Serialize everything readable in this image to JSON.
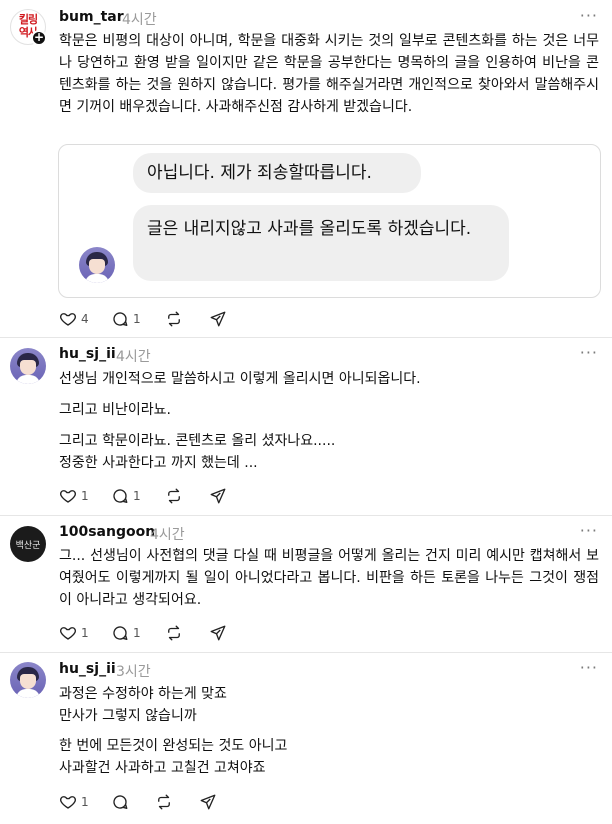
{
  "posts": [
    {
      "username": "bum_tar",
      "time": "4시간",
      "avatar_text": "킬링\n역사",
      "text": "학문은 비평의 대상이 아니며, 학문을 대중화 시키는 것의 일부로 콘텐츠화를 하는 것은 너무나 당연하고 환영 받을 일이지만 같은 학문을 공부한다는 명목하의 글을 인용하여 비난을 콘텐츠화를 하는 것을 원하지 않습니다. 평가를 해주실거라면 개인적으로 찾아와서 말씀해주시면 기꺼이 배우겠습니다. 사과해주신점 감사하게 받겠습니다.",
      "quote": {
        "bubble_1": "아닙니다. 제가 죄송할따릅니다.",
        "bubble_2": "글은 내리지않고 사과를 올리도록 하겠습니다."
      },
      "likes": "4",
      "replies": "1"
    },
    {
      "username": "hu_sj_ii",
      "time": "4시간",
      "paragraphs": [
        "선생님 개인적으로 말씀하시고 이렇게 올리시면 아니되옵니다.",
        "그리고 비난이라뇨.",
        "그리고 학문이라뇨. 콘텐츠로 올리 셨자나요.....\n정중한 사과한다고 까지 했는데 ..."
      ],
      "likes": "1",
      "replies": "1"
    },
    {
      "username": "100sangoon",
      "time": "4시간",
      "avatar_text": "백산군",
      "text": "그... 선생님이 사전협의 댓글 다실 때 비평글을 어떻게 올리는 건지 미리 예시만 캡쳐해서 보여줬어도 이렇게까지 될 일이 아니었다라고 봅니다. 비판을 하든 토론을 나누든 그것이 쟁점이 아니라고 생각되어요.",
      "likes": "1",
      "replies": "1"
    },
    {
      "username": "hu_sj_ii",
      "time": "3시간",
      "paragraphs": [
        "과정은 수정하야 하는게 맞죠\n만사가 그렇지 않습니까",
        "한 번에 모든것이 완성되는 것도 아니고\n사과할건 사과하고 고칠건 고쳐야죠"
      ],
      "likes": "1"
    }
  ],
  "icons": {
    "more": "more-icon",
    "like": "heart-icon",
    "reply": "comment-icon",
    "repost": "repost-icon",
    "share": "share-icon"
  }
}
